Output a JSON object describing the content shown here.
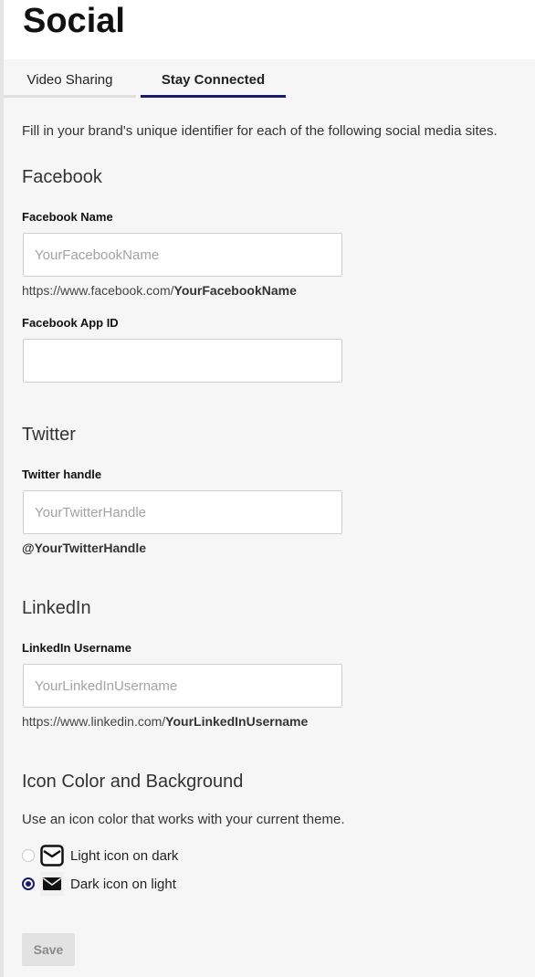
{
  "page": {
    "title": "Social"
  },
  "tabs": [
    {
      "label": "Video Sharing",
      "active": false
    },
    {
      "label": "Stay Connected",
      "active": true
    }
  ],
  "intro": "Fill in your brand's unique identifier for each of the following social media sites.",
  "facebook": {
    "heading": "Facebook",
    "name_label": "Facebook Name",
    "name_value": "",
    "name_placeholder": "YourFacebookName",
    "url_prefix": "https://www.facebook.com/",
    "url_suffix": "YourFacebookName",
    "app_id_label": "Facebook App ID",
    "app_id_value": ""
  },
  "twitter": {
    "heading": "Twitter",
    "handle_label": "Twitter handle",
    "handle_value": "",
    "handle_placeholder": "YourTwitterHandle",
    "hint": "@YourTwitterHandle"
  },
  "linkedin": {
    "heading": "LinkedIn",
    "username_label": "LinkedIn Username",
    "username_value": "",
    "username_placeholder": "YourLinkedInUsername",
    "url_prefix": "https://www.linkedin.com/",
    "url_suffix": "YourLinkedInUsername"
  },
  "icon_color": {
    "heading": "Icon Color and Background",
    "description": "Use an icon color that works with your current theme.",
    "options": [
      {
        "label": "Light icon on dark",
        "selected": false,
        "icon": "mail-outline-icon"
      },
      {
        "label": "Dark icon on light",
        "selected": true,
        "icon": "mail-filled-icon"
      }
    ]
  },
  "actions": {
    "save_label": "Save"
  },
  "colors": {
    "accent": "#1a1a6e",
    "panel_bg": "#f6f6f6",
    "button_disabled_bg": "#e2e2e2"
  }
}
